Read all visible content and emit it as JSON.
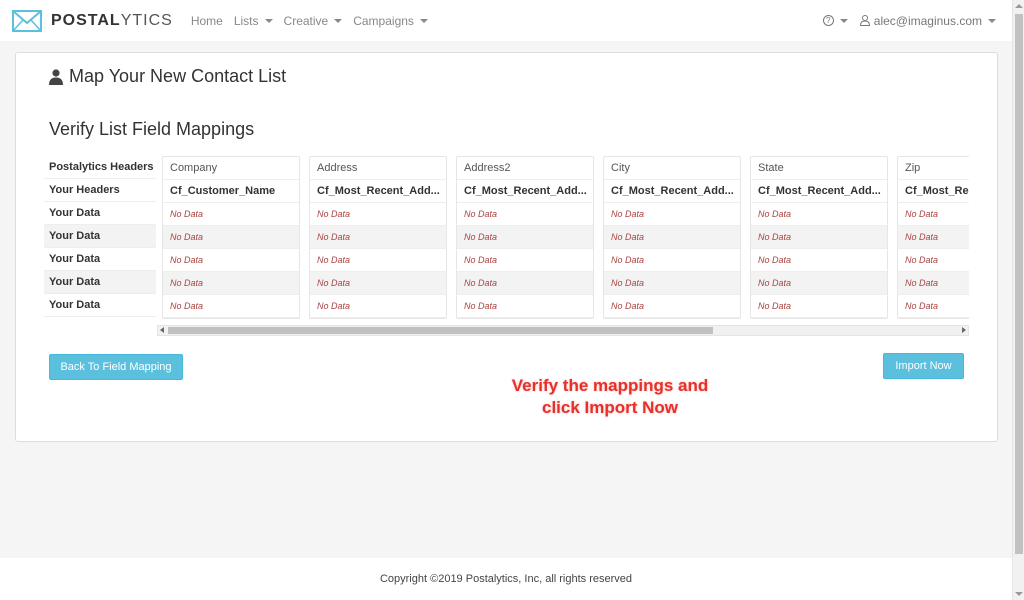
{
  "brand": {
    "name_bold": "POSTAL",
    "name_light": "YTICS"
  },
  "nav": {
    "links": [
      {
        "label": "Home",
        "dropdown": false
      },
      {
        "label": "Lists",
        "dropdown": true
      },
      {
        "label": "Creative",
        "dropdown": true
      },
      {
        "label": "Campaigns",
        "dropdown": true
      }
    ],
    "user_email": "alec@imaginus.com"
  },
  "page": {
    "title": "Map Your New Contact List",
    "section_title": "Verify List Field Mappings"
  },
  "mapping": {
    "row_labels": [
      "Postalytics Headers",
      "Your Headers",
      "Your Data",
      "Your Data",
      "Your Data",
      "Your Data",
      "Your Data"
    ],
    "no_data_text": "No Data",
    "columns": [
      {
        "header": "Company",
        "your_header": "Cf_Customer_Name"
      },
      {
        "header": "Address",
        "your_header": "Cf_Most_Recent_Add..."
      },
      {
        "header": "Address2",
        "your_header": "Cf_Most_Recent_Add..."
      },
      {
        "header": "City",
        "your_header": "Cf_Most_Recent_Add..."
      },
      {
        "header": "State",
        "your_header": "Cf_Most_Recent_Add..."
      },
      {
        "header": "Zip",
        "your_header": "Cf_Most_Recent_Add..."
      }
    ]
  },
  "buttons": {
    "back": "Back To Field Mapping",
    "import": "Import Now"
  },
  "annotation": {
    "line1": "Verify the mappings and",
    "line2": "click Import Now"
  },
  "footer": {
    "copyright": "Copyright ©2019 Postalytics, Inc, all rights reserved"
  },
  "colors": {
    "accent": "#5bc0de",
    "no_data": "#a94442",
    "annotation": "#e8302a"
  }
}
